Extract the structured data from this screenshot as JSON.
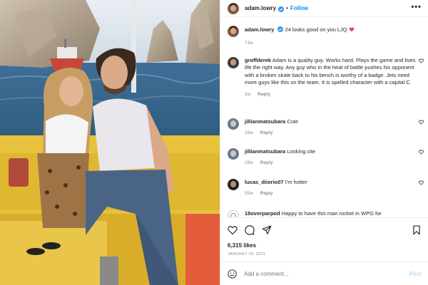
{
  "header": {
    "username": "adam.lowry",
    "separator": "•",
    "follow_label": "Follow",
    "more_label": "•••"
  },
  "caption": {
    "username": "adam.lowry",
    "text": "24 looks good on you LJQ",
    "time": "73w"
  },
  "comments": [
    {
      "username": "groffderek",
      "text": "Adam is a quality guy. Works hard. Plays the game and lives life the right way. Any guy who in the heat of battle pushes his opponent with a broken skate back to his bench is worthy of a badge. Jets need more guys like this on the team. It is spelled character with a capital C.",
      "time": "3w",
      "reply": "Reply"
    },
    {
      "username": "jillianmatsubara",
      "text": "Cute",
      "time": "28w",
      "reply": "Reply"
    },
    {
      "username": "jillianmatsubara",
      "text": "Looking cite",
      "time": "28w",
      "reply": "Reply"
    },
    {
      "username": "lucas_diiorio07",
      "text": "I'm hotter",
      "time": "55w",
      "reply": "Reply"
    },
    {
      "username": "18overparpod",
      "text": "Happy to have this man rocket in WPG for"
    }
  ],
  "stats": {
    "likes": "6,315 likes",
    "date": "JANUARY 29, 2021"
  },
  "add_comment": {
    "placeholder": "Add a comment...",
    "post_label": "Post"
  },
  "colors": {
    "accent": "#0095f6",
    "muted": "#8e8e8e",
    "post_disabled": "#b2dffc"
  },
  "icons": [
    "verified-badge-icon",
    "more-options-icon",
    "heart-icon",
    "comment-icon",
    "share-icon",
    "bookmark-icon",
    "emoji-icon",
    "red-heart-emoji-icon"
  ]
}
